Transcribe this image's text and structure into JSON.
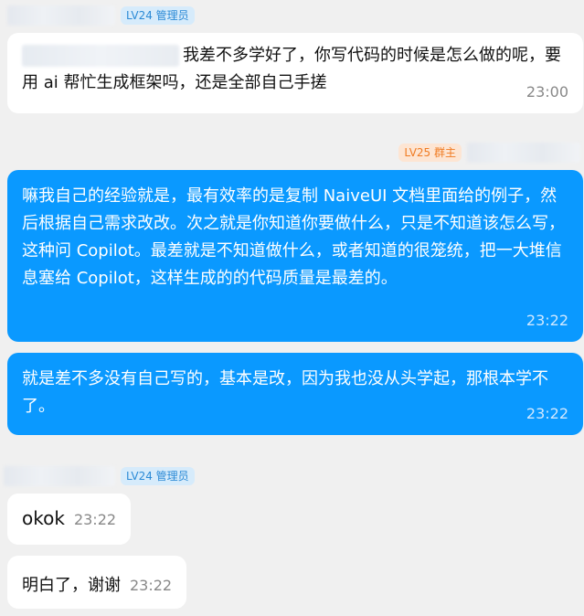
{
  "messages": [
    {
      "sender_badge": "LV24 管理员",
      "text": "我差不多学好了，你写代码的时候是怎么做的呢，要用 ai 帮忙生成框架吗，还是全部自己手搓",
      "time": "23:00"
    },
    {
      "sender_badge": "LV25 群主",
      "text": "嘛我自己的经验就是，最有效率的是复制 NaiveUI 文档里面给的例子，然后根据自己需求改改。次之就是你知道你要做什么，只是不知道该怎么写，这种问 Copilot。最差就是不知道做什么，或者知道的很笼统，把一大堆信息塞给 Copilot，这样生成的的代码质量是最差的。",
      "time": "23:22"
    },
    {
      "text": "就是差不多没有自己写的，基本是改，因为我也没从头学起，那根本学不了。",
      "time": "23:22"
    },
    {
      "sender_badge": "LV24 管理员",
      "text": "okok",
      "time": "23:22"
    },
    {
      "text": "明白了，谢谢",
      "time": "23:22"
    }
  ]
}
